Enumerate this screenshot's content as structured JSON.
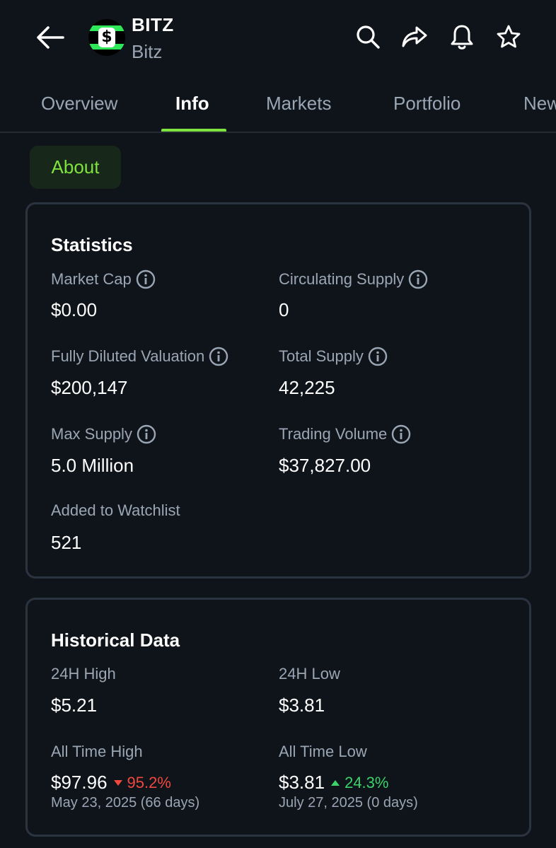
{
  "header": {
    "symbol": "BITZ",
    "name": "Bitz"
  },
  "tabs": [
    {
      "label": "Overview",
      "active": false
    },
    {
      "label": "Info",
      "active": true
    },
    {
      "label": "Markets",
      "active": false
    },
    {
      "label": "Portfolio",
      "active": false
    },
    {
      "label": "News",
      "active": false
    }
  ],
  "section_chip": "About",
  "statistics": {
    "title": "Statistics",
    "market_cap": {
      "label": "Market Cap",
      "value": "$0.00"
    },
    "circulating_supply": {
      "label": "Circulating Supply",
      "value": "0"
    },
    "fully_diluted_valuation": {
      "label": "Fully Diluted Valuation",
      "value": "$200,147"
    },
    "total_supply": {
      "label": "Total Supply",
      "value": "42,225"
    },
    "max_supply": {
      "label": "Max Supply",
      "value": "5.0 Million"
    },
    "trading_volume": {
      "label": "Trading Volume",
      "value": "$37,827.00"
    },
    "watchlist": {
      "label": "Added to Watchlist",
      "value": "521"
    }
  },
  "historical": {
    "title": "Historical Data",
    "high_24h": {
      "label": "24H High",
      "value": "$5.21"
    },
    "low_24h": {
      "label": "24H Low",
      "value": "$3.81"
    },
    "ath": {
      "label": "All Time High",
      "value": "$97.96",
      "change": "95.2%",
      "direction": "down",
      "date": "May 23, 2025 (66 days)"
    },
    "atl": {
      "label": "All Time Low",
      "value": "$3.81",
      "change": "24.3%",
      "direction": "up",
      "date": "July 27, 2025 (0 days)"
    }
  },
  "colors": {
    "background": "#0f141a",
    "accent": "#7fe33f",
    "negative": "#f0483e",
    "positive": "#3bd26a",
    "muted_text": "#9aa6b4"
  },
  "icons": [
    "back-arrow-icon",
    "search-icon",
    "share-icon",
    "bell-icon",
    "star-icon",
    "info-icon",
    "triangle-down-icon",
    "triangle-up-icon"
  ]
}
